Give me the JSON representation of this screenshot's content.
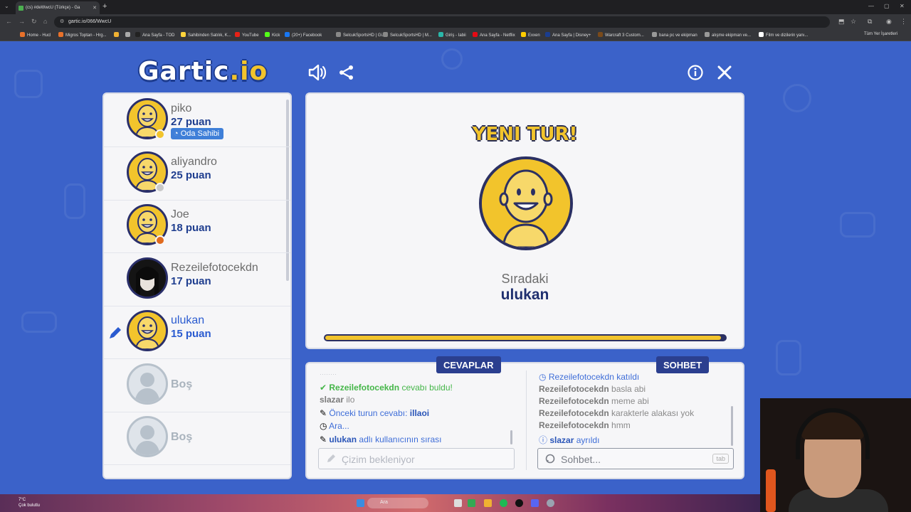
{
  "browser": {
    "tab_title": "(cs) #deWwcU (Türkçe) - Ga",
    "url": "gartic.io/066/WwcU",
    "bookmarks": [
      {
        "label": "Home - Hucl",
        "color": "#e8712a"
      },
      {
        "label": "Migros Toptan - Hrg...",
        "color": "#e8712a"
      },
      {
        "label": "",
        "color": "#f0b132"
      },
      {
        "label": "",
        "color": "#aaaaaa"
      },
      {
        "label": "Ana Sayfa - TOD",
        "color": "#222222"
      },
      {
        "label": "Sahibinden Satılık, K...",
        "color": "#ffd43b"
      },
      {
        "label": "YouTube",
        "color": "#e62117"
      },
      {
        "label": "Kick",
        "color": "#53fc18"
      },
      {
        "label": "(20+) Facebook",
        "color": "#1877f2"
      },
      {
        "label": "SelcukSportsHD | Gi...",
        "color": "#888888"
      },
      {
        "label": "SelcukSportsHD | M...",
        "color": "#888888"
      },
      {
        "label": "Giriş - Iabii",
        "color": "#2ab7a9"
      },
      {
        "label": "Ana Sayfa - Netflix",
        "color": "#e50914"
      },
      {
        "label": "Exxen",
        "color": "#ffcc00"
      },
      {
        "label": "Ana Sayfa | Disney+",
        "color": "#1a3d8f"
      },
      {
        "label": "Warcraft 3 Custom...",
        "color": "#7a4a1a"
      },
      {
        "label": "bana pc ve ekipman",
        "color": "#999999"
      },
      {
        "label": "alışme ekipman ve...",
        "color": "#999999"
      },
      {
        "label": "Film ve dizilerin yanı...",
        "color": "#ffffff"
      }
    ],
    "all_bookmarks": "Tüm Yer İşaretleri"
  },
  "logo": {
    "main": "Gartic",
    "suffix": ".io"
  },
  "icons": {
    "sound": "speaker-icon",
    "share": "share-icon",
    "info": "info-icon",
    "close": "close-icon"
  },
  "players": [
    {
      "name": "piko",
      "points": "27 puan",
      "badge": "Oda Sahibi",
      "status_color": "#f2c42c",
      "type": "avatar"
    },
    {
      "name": "aliyandro",
      "points": "25 puan",
      "status_color": "#c9c9c9",
      "type": "avatar"
    },
    {
      "name": "Joe",
      "points": "18 puan",
      "status_color": "#e06a1e",
      "type": "avatar"
    },
    {
      "name": "Rezeilefotocekdn",
      "points": "17 puan",
      "type": "photo"
    },
    {
      "name": "ulukan",
      "points": "15 puan",
      "type": "avatar",
      "drawing": true
    },
    {
      "name": "Boş",
      "type": "empty"
    },
    {
      "name": "Boş",
      "type": "empty"
    }
  ],
  "round": {
    "title": "YENI TUR!",
    "next_label": "Sıradaki",
    "next_user": "ulukan",
    "timer_progress": 0.99
  },
  "answers": {
    "tab_label": "CEVAPLAR",
    "messages": [
      {
        "user": "Rezeilefotocekdn",
        "text": "cevabı buldu!",
        "kind": "correct"
      },
      {
        "user": "slazar",
        "text": "ilo",
        "kind": "guess"
      },
      {
        "user": "Önceki turun cevabı:",
        "text": "illaoi",
        "kind": "prev"
      },
      {
        "user": "Ara...",
        "text": "",
        "kind": "pause"
      },
      {
        "user": "ulukan",
        "text": "adlı kullanıcının sırası",
        "kind": "turn"
      }
    ],
    "input_placeholder": "Çizim bekleniyor"
  },
  "chat": {
    "tab_label": "SOHBET",
    "messages": [
      {
        "user": "Rezeilefotocekdn",
        "text": "katıldı",
        "kind": "join"
      },
      {
        "user": "Rezeilefotocekdn",
        "text": "basla abi",
        "kind": "chat"
      },
      {
        "user": "Rezeilefotocekdn",
        "text": "meme abi",
        "kind": "chat"
      },
      {
        "user": "Rezeilefotocekdn",
        "text": "karakterle alakası yok",
        "kind": "chat"
      },
      {
        "user": "Rezeilefotocekdn",
        "text": "hmm",
        "kind": "chat"
      },
      {
        "user": "slazar",
        "text": "ayrıldı",
        "kind": "leave"
      }
    ],
    "input_placeholder": "Sohbet...",
    "shortcut": "tab"
  },
  "taskbar": {
    "weather_temp": "7°C",
    "weather_text": "Çok bulutlu",
    "search_label": "Ara"
  }
}
